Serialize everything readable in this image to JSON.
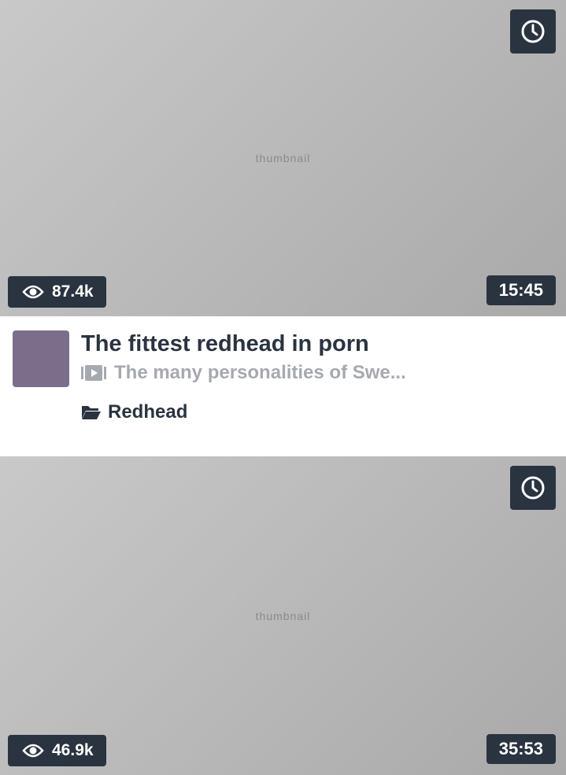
{
  "cards": [
    {
      "views": "87.4k",
      "duration": "15:45",
      "title": "The fittest redhead in porn",
      "channel": "The many personalities of Swe...",
      "category": "Redhead"
    },
    {
      "views": "46.9k",
      "duration": "35:53"
    }
  ],
  "icons": {
    "watch_later": "clock-icon",
    "views": "eye-icon",
    "channel": "video-icon",
    "category": "folder-icon"
  },
  "colors": {
    "badge_bg": "#2a3340",
    "title": "#2a3340",
    "channel": "#a6aab0"
  }
}
